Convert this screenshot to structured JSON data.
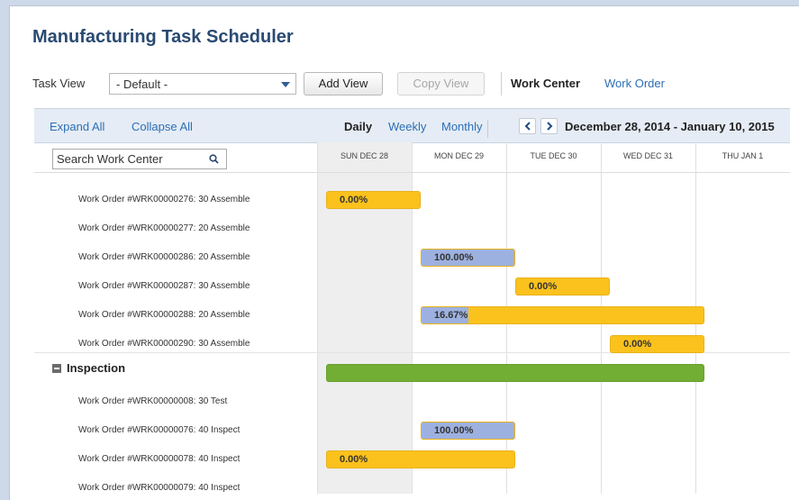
{
  "title": "Manufacturing Task Scheduler",
  "toolbar": {
    "task_view_label": "Task View",
    "task_view_selected": "- Default -",
    "add_view": "Add View",
    "copy_view": "Copy View",
    "work_center": "Work Center",
    "work_order": "Work Order"
  },
  "header": {
    "expand_all": "Expand All",
    "collapse_all": "Collapse All",
    "daily": "Daily",
    "weekly": "Weekly",
    "monthly": "Monthly",
    "date_range": "December 28, 2014 - January 10, 2015"
  },
  "search": {
    "placeholder": "Search Work Center"
  },
  "columns": [
    "SUN DEC 28",
    "MON DEC 29",
    "TUE DEC 30",
    "WED DEC 31",
    "THU JAN 1"
  ],
  "colors": {
    "pending": "#fbc21d",
    "progress": "#9db1e0",
    "group": "#72ad34"
  },
  "rows": [
    {
      "label": "Work Order #WRK00000276: 30 Assemble",
      "bar": {
        "start": 0,
        "end": 1,
        "progress": 0,
        "text": "0.00%"
      }
    },
    {
      "label": "Work Order #WRK00000277: 20 Assemble",
      "bar": null
    },
    {
      "label": "Work Order #WRK00000286: 20 Assemble",
      "bar": {
        "start": 1,
        "end": 2,
        "progress": 1,
        "text": "100.00%"
      }
    },
    {
      "label": "Work Order #WRK00000287: 30 Assemble",
      "bar": {
        "start": 2,
        "end": 3,
        "progress": 0,
        "text": "0.00%"
      }
    },
    {
      "label": "Work Order #WRK00000288: 20 Assemble",
      "bar": {
        "start": 1,
        "end": 4,
        "progress": 0.1667,
        "text": "16.67%"
      }
    },
    {
      "label": "Work Order #WRK00000290: 30 Assemble",
      "bar": {
        "start": 3,
        "end": 4,
        "progress": 0,
        "text": "0.00%"
      }
    }
  ],
  "group": {
    "label": "Inspection",
    "bar": {
      "start": 0,
      "end": 4
    },
    "rows": [
      {
        "label": "Work Order #WRK00000008: 30 Test",
        "bar": null
      },
      {
        "label": "Work Order #WRK00000076: 40 Inspect",
        "bar": {
          "start": 1,
          "end": 2,
          "progress": 1,
          "text": "100.00%"
        }
      },
      {
        "label": "Work Order #WRK00000078: 40 Inspect",
        "bar": {
          "start": 0,
          "end": 2,
          "progress": 0,
          "text": "0.00%"
        }
      },
      {
        "label": "Work Order #WRK00000079: 40 Inspect",
        "bar": null
      }
    ]
  }
}
